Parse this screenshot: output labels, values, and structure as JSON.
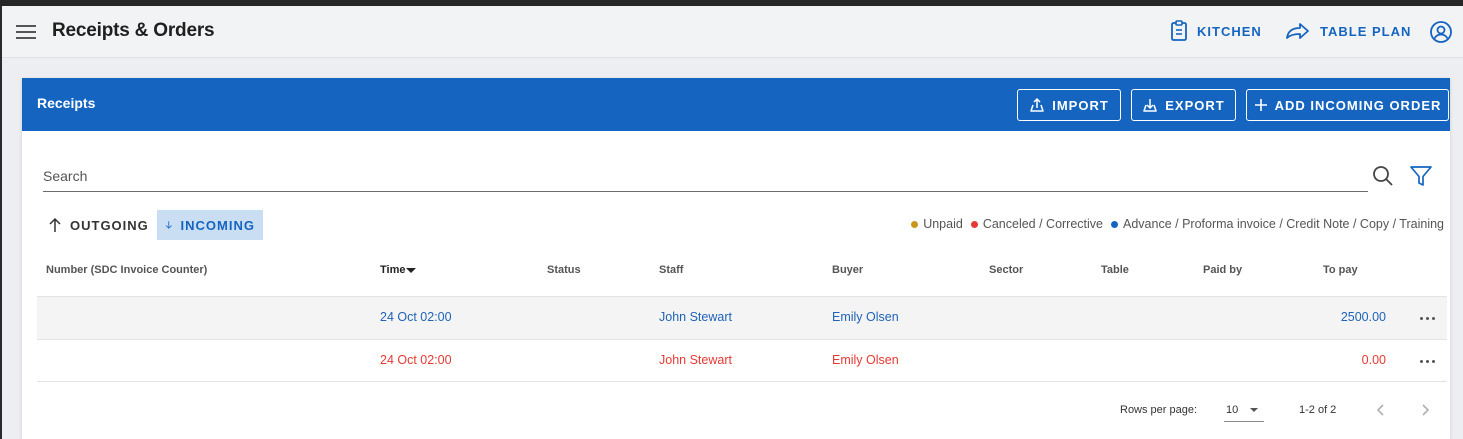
{
  "appbar": {
    "title": "Receipts & Orders",
    "kitchen_label": "KITCHEN",
    "table_plan_label": "TABLE PLAN",
    "icons": [
      "menu-icon",
      "clipboard-icon",
      "share-arrow-icon",
      "account-icon"
    ]
  },
  "card": {
    "title": "Receipts",
    "import_label": "IMPORT",
    "export_label": "EXPORT",
    "add_label": "ADD INCOMING ORDER"
  },
  "search": {
    "placeholder": "Search"
  },
  "direction_tabs": {
    "outgoing": "OUTGOING",
    "incoming": "INCOMING",
    "selected": "INCOMING"
  },
  "legend": [
    {
      "label": "Unpaid",
      "color": "#c9961a"
    },
    {
      "label": "Canceled / Corrective",
      "color": "#e53935"
    },
    {
      "label": "Advance / Proforma invoice / Credit Note / Copy / Training",
      "color": "#1565c0"
    }
  ],
  "table": {
    "columns": [
      "Number (SDC Invoice Counter)",
      "Time",
      "Status",
      "Staff",
      "Buyer",
      "Sector",
      "Table",
      "Paid by",
      "To pay"
    ],
    "rows": [
      {
        "number": "",
        "time": "24 Oct 02:00",
        "status": "",
        "staff": "John Stewart",
        "buyer": "Emily Olsen",
        "sector": "",
        "table": "",
        "paid_by": "",
        "to_pay": "2500.00",
        "color": "#1e63b8"
      },
      {
        "number": "",
        "time": "24 Oct 02:00",
        "status": "",
        "staff": "John Stewart",
        "buyer": "Emily Olsen",
        "sector": "",
        "table": "",
        "paid_by": "",
        "to_pay": "0.00",
        "color": "#e53935"
      }
    ]
  },
  "pagination": {
    "rows_per_page_label": "Rows per page:",
    "rows_per_page": "10",
    "range": "1-2 of 2"
  },
  "colors": {
    "primary": "#1565c0",
    "incoming_tab_bg": "#c9ddf3"
  }
}
